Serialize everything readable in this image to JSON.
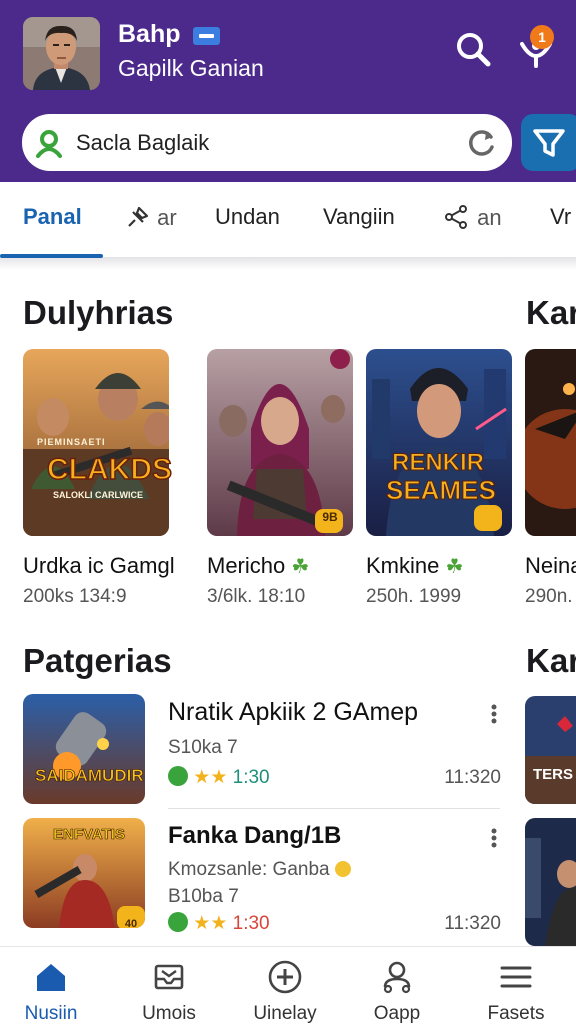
{
  "header": {
    "user_name": "Bahp",
    "user_subtitle": "Gapilk Ganian",
    "notification_count": "1",
    "accent": "#4b2a8c"
  },
  "search": {
    "value": "Sacla Baglaik",
    "placeholder": ""
  },
  "tabs": [
    {
      "label": "Panal",
      "active": true
    },
    {
      "label": "ar",
      "icon": "pin-icon"
    },
    {
      "label": "Undan"
    },
    {
      "label": "Vangiin"
    },
    {
      "label": "an",
      "icon": "share-icon"
    },
    {
      "label": "Vr"
    }
  ],
  "sections": {
    "featured_title": "Dulyhrias",
    "featured_next_title": "Kar",
    "list_title": "Patgerias",
    "list_next_title": "Kar"
  },
  "cards": [
    {
      "title": "Urdka ic Gamgl",
      "subtitle": "200ks 134:9",
      "art_text": "CLAKDS",
      "art_top": "PIEMINSAETI",
      "art_line": "SALOKLI CARLWICE"
    },
    {
      "title": "Mericho",
      "subtitle": "3/6lk. 18:10",
      "badge": "9B"
    },
    {
      "title": "Kmkine",
      "subtitle": "250h. 1999",
      "art_text": "RENKIR",
      "art_text2": "SEAMES"
    },
    {
      "title": "Neina",
      "subtitle": "290n."
    }
  ],
  "list": [
    {
      "title": "Nratik Apkiik 2 GAmep",
      "line1": "S10ka 7",
      "rating": "1:30",
      "time": "11:320",
      "art_text": "SAIDAMUDIR"
    },
    {
      "title": "Fanka Dang/1B",
      "line1": "Kmozsanle: Ganba",
      "line2": "B10ba 7",
      "rating": "1:30",
      "time": "11:320",
      "art_text": "ENFVATIS",
      "badge": "40"
    }
  ],
  "side_art_text": "TERS",
  "bottom_nav": [
    {
      "label": "Nusiin",
      "icon": "home-icon",
      "active": true
    },
    {
      "label": "Umois",
      "icon": "mail-icon"
    },
    {
      "label": "Uinelay",
      "icon": "plus-circle-icon"
    },
    {
      "label": "Oapp",
      "icon": "person-icon"
    },
    {
      "label": "Fasets",
      "icon": "menu-icon"
    }
  ]
}
